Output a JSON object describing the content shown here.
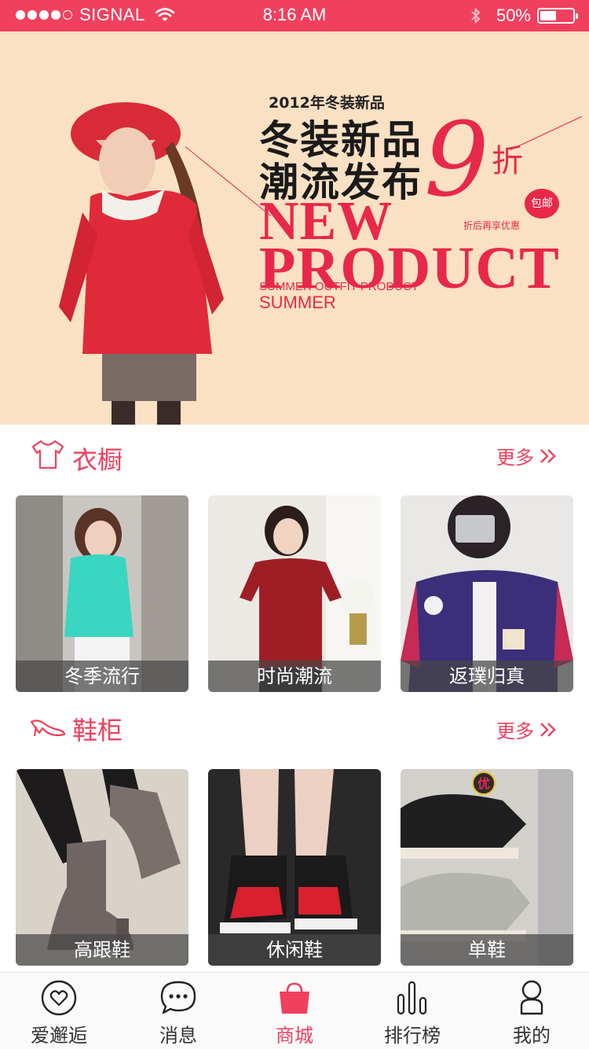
{
  "status_bar": {
    "carrier": "SIGNAL",
    "time": "8:16 AM",
    "battery_percent": "50%",
    "battery_level": 0.5,
    "signal_dots_filled": 4,
    "signal_dots_total": 5
  },
  "banner": {
    "year_line": "2012年冬装新品",
    "headline_1": "冬装新品",
    "headline_2": "潮流发布",
    "discount_number": "9",
    "discount_unit": "折",
    "free_shipping_badge": "包邮",
    "after_discount": "折后再享优惠",
    "new": "NEW",
    "product": "PRODUCT",
    "outfit_line": "SUMMER  OUTFIT PRODUCT",
    "summer": "SUMMER"
  },
  "sections": [
    {
      "title": "衣橱",
      "icon": "tshirt-icon",
      "more": "更多",
      "items": [
        {
          "label": "冬季流行"
        },
        {
          "label": "时尚潮流"
        },
        {
          "label": "返璞归真"
        }
      ]
    },
    {
      "title": "鞋柜",
      "icon": "high-heel-icon",
      "more": "更多",
      "items": [
        {
          "label": "高跟鞋"
        },
        {
          "label": "休闲鞋"
        },
        {
          "label": "单鞋"
        }
      ]
    }
  ],
  "shoe_card_badge": "优",
  "tabbar": {
    "active_index": 2,
    "tabs": [
      {
        "label": "爱邂逅",
        "icon": "heart-icon"
      },
      {
        "label": "消息",
        "icon": "chat-icon"
      },
      {
        "label": "商城",
        "icon": "shopping-bag-icon"
      },
      {
        "label": "排行榜",
        "icon": "bar-chart-icon"
      },
      {
        "label": "我的",
        "icon": "person-icon"
      }
    ]
  },
  "colors": {
    "accent": "#f0405e",
    "banner_bg": "#fbe1c3",
    "caption_bg": "#464646"
  }
}
